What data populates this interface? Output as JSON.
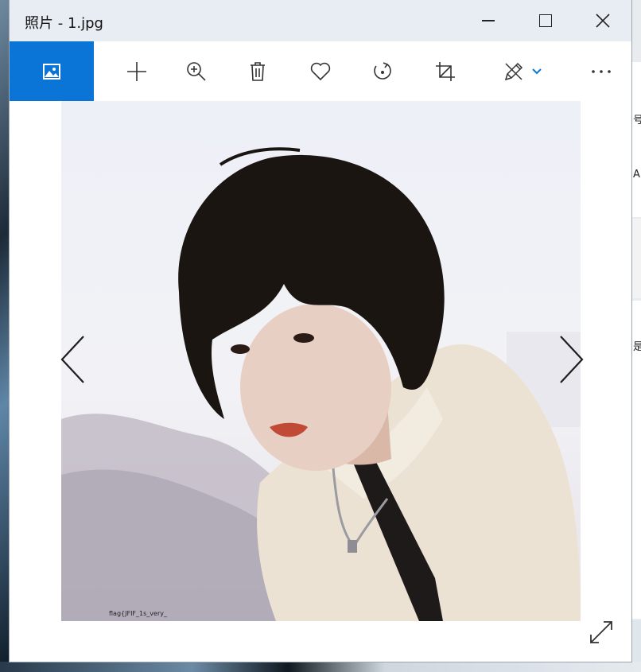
{
  "window": {
    "title": "照片 - 1.jpg"
  },
  "toolbar": {
    "items": [
      {
        "name": "photo",
        "icon": "image-icon",
        "active": true
      },
      {
        "name": "add",
        "icon": "plus-icon"
      },
      {
        "name": "zoom",
        "icon": "zoom-in-icon"
      },
      {
        "name": "delete",
        "icon": "trash-icon"
      },
      {
        "name": "favorite",
        "icon": "heart-icon"
      },
      {
        "name": "rotate",
        "icon": "rotate-icon"
      },
      {
        "name": "crop",
        "icon": "crop-icon"
      },
      {
        "name": "edit",
        "icon": "pen-draw-icon",
        "has_dropdown": true
      },
      {
        "name": "more",
        "icon": "more-icon"
      }
    ],
    "accent": "#0a74d7"
  },
  "image": {
    "filename": "1.jpg",
    "overlay_text": "flag{JFIF_1s_very_"
  },
  "navigation": {
    "prev_icon": "chevron-left-icon",
    "next_icon": "chevron-right-icon",
    "fullscreen_icon": "expand-icon"
  },
  "desktop": {
    "right_glyphs": [
      "号",
      "A",
      "是,"
    ]
  }
}
